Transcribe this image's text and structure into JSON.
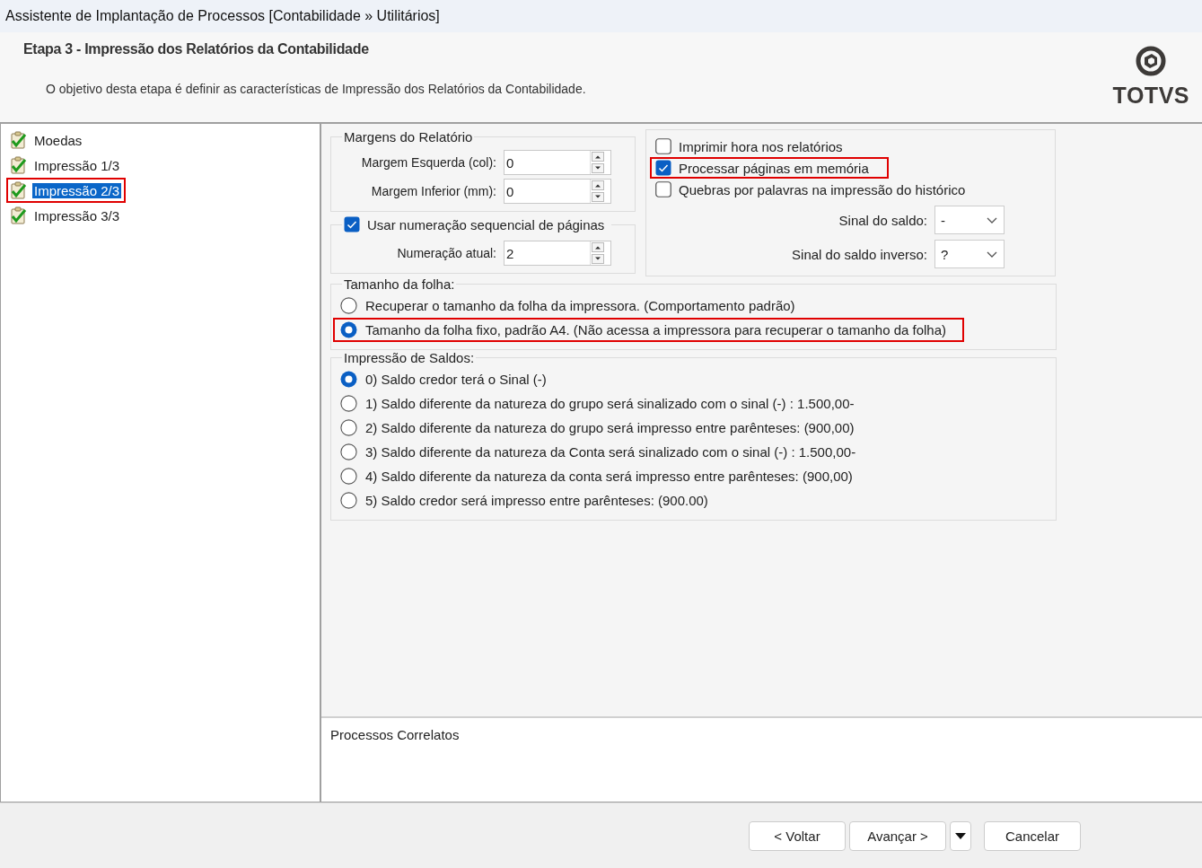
{
  "window": {
    "title": "Assistente de Implantação de Processos [Contabilidade » Utilitários]"
  },
  "header": {
    "title": "Etapa 3 - Impressão dos Relatórios da Contabilidade",
    "description": "O objetivo desta etapa é definir as características de Impressão dos Relatórios da Contabilidade.",
    "logo": "TOTVS"
  },
  "steps": [
    {
      "label": "Moedas",
      "selected": false,
      "highlighted": false
    },
    {
      "label": "Impressão 1/3",
      "selected": false,
      "highlighted": false
    },
    {
      "label": "Impressão 2/3",
      "selected": true,
      "highlighted": true
    },
    {
      "label": "Impressão 3/3",
      "selected": false,
      "highlighted": false
    }
  ],
  "margins": {
    "title": "Margens do Relatório",
    "fields": [
      {
        "label": "Margem Esquerda (col):",
        "value": "0"
      },
      {
        "label": "Margem Inferior (mm):",
        "value": "0"
      }
    ]
  },
  "numbering": {
    "label": "Usar numeração sequencial de páginas",
    "checked": true,
    "fields": [
      {
        "label": "Numeração atual:",
        "value": "2"
      }
    ]
  },
  "options": {
    "checkboxes": [
      {
        "label": "Imprimir hora nos relatórios",
        "checked": false,
        "highlighted": false
      },
      {
        "label": "Processar páginas em memória",
        "checked": true,
        "highlighted": true
      },
      {
        "label": "Quebras por palavras na impressão do histórico",
        "checked": false,
        "highlighted": false
      }
    ],
    "selects": [
      {
        "label": "Sinal do saldo:",
        "value": "-"
      },
      {
        "label": "Sinal do saldo inverso:",
        "value": "?"
      }
    ]
  },
  "sheet_size": {
    "title": "Tamanho da folha:",
    "options": [
      {
        "label": "Recuperar o tamanho da folha da impressora. (Comportamento padrão)",
        "selected": false,
        "highlighted": false
      },
      {
        "label": "Tamanho da folha fixo, padrão A4. (Não acessa a impressora para recuperar o tamanho da folha)",
        "selected": true,
        "highlighted": true
      }
    ]
  },
  "balance_printing": {
    "title": "Impressão de Saldos:",
    "options": [
      {
        "label": "0) Saldo credor terá o Sinal (-)",
        "selected": true,
        "highlighted": false
      },
      {
        "label": "1) Saldo diferente da natureza do grupo será sinalizado com o sinal (-) :  1.500,00-",
        "selected": false,
        "highlighted": false
      },
      {
        "label": "2) Saldo diferente da natureza do grupo será impresso entre parênteses:  (900,00)",
        "selected": false,
        "highlighted": false
      },
      {
        "label": "3) Saldo diferente da natureza da Conta será sinalizado com o sinal (-) :  1.500,00-",
        "selected": false,
        "highlighted": false
      },
      {
        "label": "4) Saldo diferente da natureza da conta será impresso entre parênteses:  (900,00)",
        "selected": false,
        "highlighted": false
      },
      {
        "label": "5) Saldo credor será impresso entre parênteses: (900.00)",
        "selected": false,
        "highlighted": false
      }
    ]
  },
  "related": {
    "title": "Processos Correlatos"
  },
  "buttons": [
    {
      "kind": "button",
      "label": "< Voltar"
    },
    {
      "kind": "button",
      "label": "Avançar >"
    },
    {
      "kind": "dropdown"
    },
    {
      "kind": "button",
      "label": "Cancelar"
    }
  ]
}
